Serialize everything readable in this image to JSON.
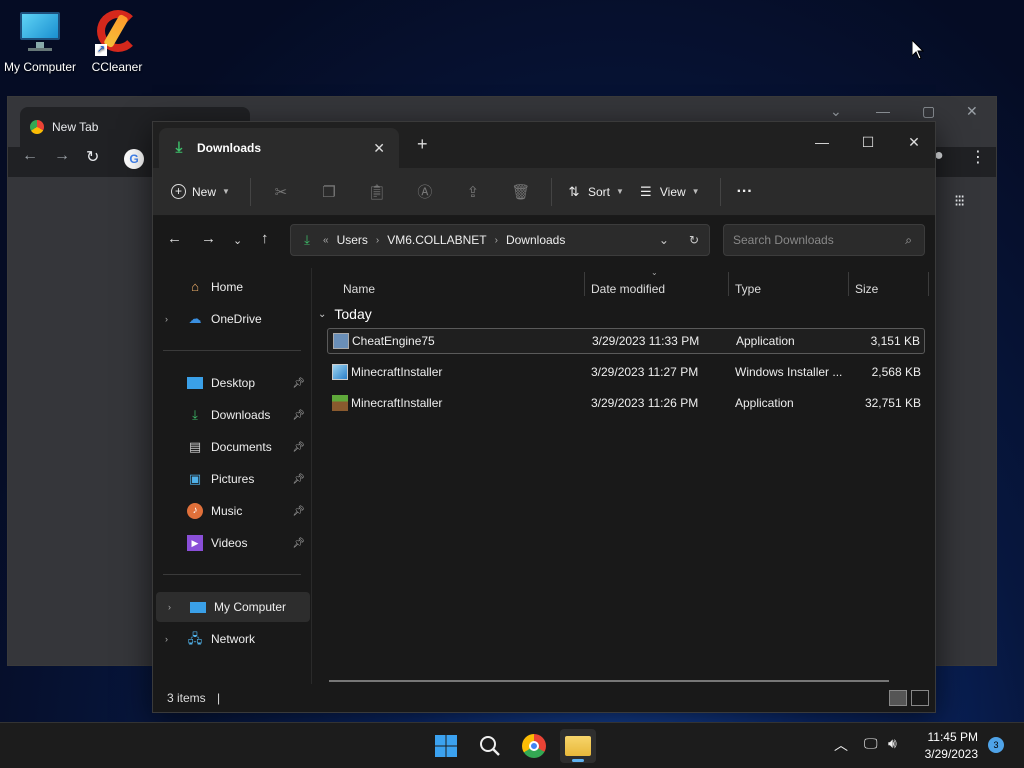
{
  "desktop": {
    "icons": [
      {
        "label": "My Computer"
      },
      {
        "label": "CCleaner"
      }
    ]
  },
  "chrome": {
    "tab_label": "New Tab"
  },
  "explorer": {
    "tab_title": "Downloads",
    "toolbar": {
      "new_label": "New",
      "sort_label": "Sort",
      "view_label": "View",
      "more_label": "···"
    },
    "address": {
      "prefix": "«",
      "segments": [
        "Users",
        "VM6.COLLABNET",
        "Downloads"
      ]
    },
    "search_placeholder": "Search Downloads",
    "sidebar": {
      "items": [
        {
          "label": "Home"
        },
        {
          "label": "OneDrive"
        },
        {
          "label": "Desktop"
        },
        {
          "label": "Downloads"
        },
        {
          "label": "Documents"
        },
        {
          "label": "Pictures"
        },
        {
          "label": "Music"
        },
        {
          "label": "Videos"
        },
        {
          "label": "My Computer"
        },
        {
          "label": "Network"
        }
      ]
    },
    "columns": {
      "name": "Name",
      "date": "Date modified",
      "type": "Type",
      "size": "Size"
    },
    "group_label": "Today",
    "files": [
      {
        "name": "CheatEngine75",
        "date": "3/29/2023 11:33 PM",
        "type": "Application",
        "size": "3,151 KB"
      },
      {
        "name": "MinecraftInstaller",
        "date": "3/29/2023 11:27 PM",
        "type": "Windows Installer ...",
        "size": "2,568 KB"
      },
      {
        "name": "MinecraftInstaller",
        "date": "3/29/2023 11:26 PM",
        "type": "Application",
        "size": "32,751 KB"
      }
    ],
    "status": "3 items"
  },
  "taskbar": {
    "time": "11:45 PM",
    "date": "3/29/2023",
    "notifications": "3"
  },
  "colors": {
    "accent": "#5fb2f0",
    "download_green": "#3dbf6a"
  }
}
